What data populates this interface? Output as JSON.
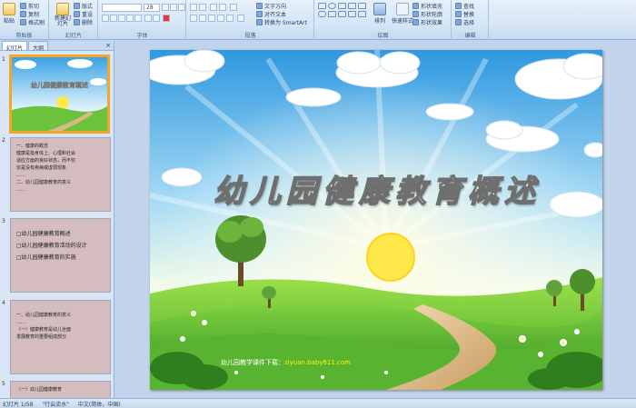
{
  "ribbon": {
    "clipboard": {
      "label": "剪贴板",
      "paste": "粘贴",
      "cut": "剪切",
      "copy": "复制",
      "format_painter": "格式刷"
    },
    "slides": {
      "label": "幻灯片",
      "new_slide": "新建幻灯片",
      "layout": "版式",
      "reset": "重设",
      "delete": "删除"
    },
    "font": {
      "label": "字体",
      "font_size": "28"
    },
    "paragraph": {
      "label": "段落",
      "text_direction": "文字方向",
      "align_text": "对齐文本",
      "smartart": "转换为 SmartArt"
    },
    "drawing": {
      "label": "绘图",
      "arrange": "排列",
      "quick_styles": "快速样式",
      "shape_fill": "形状填充",
      "shape_outline": "形状轮廓",
      "shape_effects": "形状效果"
    },
    "editing": {
      "label": "编辑",
      "find": "查找",
      "replace": "替换",
      "select": "选择"
    }
  },
  "panel": {
    "tabs": [
      "幻灯片",
      "大纲"
    ],
    "close": "×",
    "thumb_title": "幼儿园健康教育概述",
    "slides": [
      {
        "num": "1"
      },
      {
        "num": "2",
        "lines": [
          "一、健康的概念",
          "健康是指身体上、心理和社会",
          "适应方面的良好状态，而不仅",
          "仅是没有疾病或虚弱现象",
          "……",
          "二、幼儿园健康教育的意义",
          "……"
        ]
      },
      {
        "num": "3",
        "lines": [
          "□幼儿园健康教育概述",
          "□幼儿园健康教育活动的设计",
          "□幼儿园健康教育的实施"
        ]
      },
      {
        "num": "4",
        "lines": [
          "一、幼儿园健康教育的意义",
          "……",
          "（一）健康教育是幼儿全面",
          "发展教育的重要组成部分"
        ]
      },
      {
        "num": "5",
        "lines": [
          "（一）幼儿园健康教育"
        ]
      }
    ]
  },
  "slide": {
    "title": "幼儿园健康教育概述",
    "footer_text": "幼儿园教学课件下载：",
    "footer_url": "ziyuan.baby611.com"
  },
  "status": {
    "slide_count": "幻灯片 1/58",
    "theme": "\"行云流水\"",
    "language": "中文(简体，中国)"
  },
  "colors": {
    "sky_top": "#3aa3e6",
    "sun": "#ffe84a",
    "grass": "#6cc23a",
    "title_outline": "#6f6f6f",
    "selection": "#f5a623"
  }
}
